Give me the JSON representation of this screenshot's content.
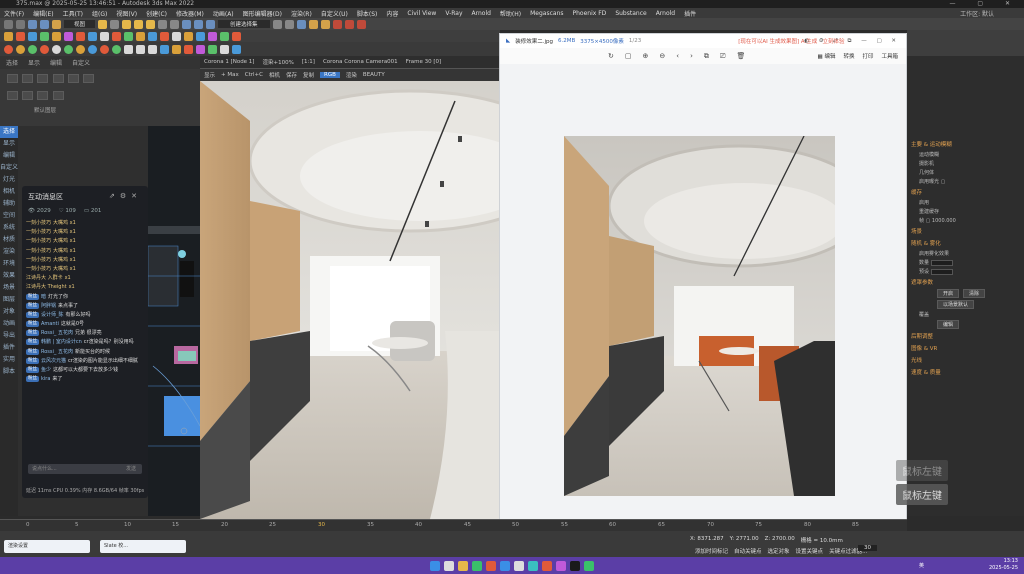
{
  "window": {
    "title": "375.max @ 2025-05-25 13:46:51 - Autodesk 3ds Max 2022",
    "controls": "— ▢ ✕"
  },
  "menubar": {
    "items": [
      "文件(F)",
      "编辑(E)",
      "工具(T)",
      "组(G)",
      "视图(V)",
      "创建(C)",
      "修改器(M)",
      "动画(A)",
      "图形编辑器(D)",
      "渲染(R)",
      "自定义(U)",
      "脚本(S)",
      "内容",
      "Civil View",
      "V-Ray",
      "Arnold",
      "帮助(H)",
      "Megascans",
      "Phoenix FD",
      "Substance",
      "Arnold",
      "插件"
    ],
    "workspace": "工作区: 默认"
  },
  "toolbar": {
    "view_select": "视图",
    "selection_set": "创建选择集"
  },
  "left_panel": {
    "tabs": [
      "选择",
      "显示",
      "编辑",
      "自定义",
      "场景资源管理器"
    ],
    "layer_label": "默认图层"
  },
  "left_strip": {
    "items": [
      "选择",
      "显示",
      "编辑",
      "自定义",
      "灯光",
      "相机",
      "辅助",
      "空间",
      "系统",
      "材质",
      "渲染",
      "环境",
      "效果",
      "场景",
      "图层",
      "对象",
      "动画",
      "导出",
      "插件",
      "实用",
      "脚本",
      "其他"
    ]
  },
  "chat": {
    "title": "互动消息区",
    "stats": {
      "viewers": "2029",
      "likes": "109",
      "comments": "201"
    },
    "messages": [
      {
        "user": "一刻小技巧",
        "text": "大嘴鸡 x1",
        "gift": true
      },
      {
        "user": "一刻小技巧",
        "text": "大嘴鸡 x1",
        "gift": true
      },
      {
        "user": "一刻小技巧",
        "text": "大嘴鸡 x1",
        "gift": true
      },
      {
        "user": "一刻小技巧",
        "text": "大嘴鸡 x1",
        "gift": true
      },
      {
        "user": "一刻小技巧",
        "text": "大嘴鸡 x1",
        "gift": true
      },
      {
        "user": "一刻小技巧",
        "text": "大嘴鸡 x1",
        "gift": true
      },
      {
        "user": "江诗丹大 入群卡",
        "text": "x1",
        "gift": true
      },
      {
        "user": "江诗丹大 Theight",
        "text": "x1",
        "gift": true
      },
      {
        "badge": "粉丝",
        "user": "暗",
        "text": "灯光了你"
      },
      {
        "badge": "粉丝",
        "user": "阿胖锅",
        "text": "来点事了"
      },
      {
        "badge": "粉丝",
        "user": "设计师_陈",
        "text": "有那么好吗"
      },
      {
        "badge": "粉丝",
        "user": "Amanti",
        "text": "这就是0号"
      },
      {
        "badge": "粉丝",
        "user": "Rossi_ 五花肉",
        "text": "兄弟 很漂亮"
      },
      {
        "badge": "粉丝",
        "user": "韩鹏 | 室内设计cn",
        "text": "cr渲染是吗？别没用吗"
      },
      {
        "badge": "粉丝",
        "user": "Rossi_ 五花肉",
        "text": "新能买台的时候"
      },
      {
        "badge": "粉丝",
        "user": "云风次元猫",
        "text": "cr渲染的图片能显示出细不细腻"
      },
      {
        "badge": "粉丝",
        "user": "鱼少",
        "text": "这都可以大都要下去放多少钱"
      },
      {
        "badge": "粉丝",
        "user": "kira",
        "text": "来了"
      }
    ],
    "input_placeholder": "说点什么...",
    "send": "发送",
    "footer": "延迟 11ms  CPU 0.39%  内存 8.6GB/64  帧率 30fps"
  },
  "viewport": {
    "header": [
      "Corona 1 [Node 1]",
      "渲染+100%",
      "[1:1]",
      "Corona Corona Camera001",
      "Frame 30 [0]"
    ],
    "header2": [
      "显示",
      "+ Max",
      "Ctrl+C",
      "相机",
      "保存",
      "复制",
      "RGB",
      "渲染",
      "BEAUTY"
    ],
    "active_tab": "RGB"
  },
  "viewer": {
    "file": "装修效果二.jpg",
    "size": "6.2MB",
    "resolution": "3375×4500像素",
    "ext": "1/23",
    "promo": "[现在可以AI 生成效果图] AI生成 · 立刻体验",
    "tools": [
      "↻",
      "▢",
      "⊕",
      "⊖",
      "‹",
      "›",
      "⧉",
      "⎚",
      "🗑"
    ],
    "right_tools": [
      "▦ 编辑",
      "转换",
      "打印",
      "工具箱"
    ]
  },
  "right_panel": {
    "sections": [
      {
        "title": "主要 & 运动模糊",
        "rows": [
          "运动模糊",
          "摄影机",
          "几何体",
          "启用曝光 ▢",
          "自动"
        ]
      },
      {
        "title": "缓存",
        "rows": [
          "启用",
          "重建缓存",
          "帧 ▢ 1000.000"
        ]
      },
      {
        "title": "场景",
        "rows": []
      },
      {
        "title": "随机 & 雾化",
        "rows": [
          "启用雾化效果",
          "数量",
          "预设"
        ]
      },
      {
        "title": "遮罩参数",
        "rows": [
          "启用",
          "保存",
          "以场景默认",
          "覆盖"
        ]
      },
      {
        "title": "后期调整",
        "rows": []
      },
      {
        "title": "图像 & VR",
        "rows": []
      },
      {
        "title": "光线",
        "rows": []
      },
      {
        "title": "速度 & 质量",
        "rows": []
      }
    ],
    "buttons": [
      "开启",
      "清除",
      "以场景默认",
      "编辑"
    ]
  },
  "mouse_keys": [
    "鼠标左键",
    "鼠标左键"
  ],
  "timeline": {
    "ticks": [
      "0",
      "5",
      "10",
      "15",
      "20",
      "25",
      "30",
      "35",
      "40",
      "45",
      "50",
      "55",
      "60",
      "65",
      "70",
      "75",
      "80",
      "85",
      "90",
      "95"
    ],
    "frame": "30 / 100"
  },
  "status": {
    "tabs": [
      "渲染设置",
      "Slate 校..."
    ],
    "x": "X: 8371.287",
    "y": "Y: 2771.00",
    "z": "Z: 2700.00",
    "grid": "栅格 = 10.0mm",
    "add_time": "添加时间标记",
    "autokey": "自动关键点",
    "selected": "选定对象",
    "set_key": "设置关键点",
    "filter": "关键点过滤器...",
    "frame_num": "30"
  },
  "taskbar": {
    "lang": "英",
    "time": "13:13",
    "date": "2025-05-25"
  }
}
